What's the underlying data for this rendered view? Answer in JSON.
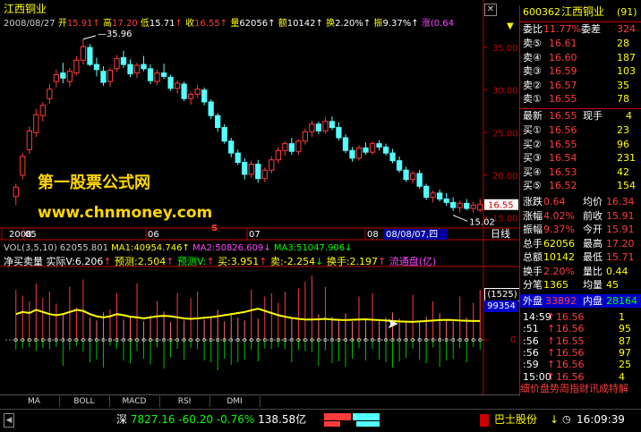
{
  "colors": {
    "up": "#ff3c3c",
    "down": "#54ffff",
    "ma_yellow": "#ffff00",
    "magenta": "#ff44ff",
    "green": "#00ff00",
    "axis": "#c00000",
    "cyan": "#00ffff"
  },
  "header": {
    "stock_name": "江西铜业",
    "date": "2008/08/27",
    "open_label": "开",
    "open": "15.91",
    "high_label": "高",
    "high": "17.20",
    "low_label": "低",
    "low": "15.71",
    "close_label": "收",
    "close": "16.55",
    "vol_label": "量",
    "vol": "62056",
    "amt_label": "额",
    "amt": "10142",
    "turnover_label": "换",
    "turnover": "2.20%",
    "amp_label": "振",
    "amp": "9.37%",
    "chg_label": "涨",
    "chg": "(0.64"
  },
  "price_axis": {
    "ticks": [
      "35.00",
      "30.00",
      "25.00",
      "20.00",
      "15.00"
    ],
    "current": "16.55",
    "hi_label": "35.96",
    "lo_label": "15.02",
    "marker": "S"
  },
  "time_axis": {
    "labels": [
      "2008",
      "05",
      "06",
      "07",
      "08"
    ],
    "cursor": "08/08/07,四",
    "period": "日线"
  },
  "vol_header": {
    "text": "VOL(3,5,10) 62055.801 ",
    "ma1": "MA1:40954.746",
    "ma2": "MA2:50826.609",
    "ma3": "MA3:51047.906"
  },
  "ind_header": {
    "name": "净买卖量",
    "actual": "实际V:6.206",
    "pred": "预测:2.504",
    "predv": "预测V:",
    "buy": "买:3.951",
    "sell": "卖:-2.254",
    "turn": "换手:2.197",
    "float": "流通盘(亿)"
  },
  "ind_axis": {
    "box1": "(1525)",
    "box2": "99354",
    "zero": "0"
  },
  "watermark": {
    "line1": "第一股票公式网",
    "line2": "www.chnmoney.com"
  },
  "tabs": [
    "MA",
    "BOLL",
    "MACD",
    "RSI",
    "DMI"
  ],
  "right_panel": {
    "code": "600362",
    "name": "江西铜业",
    "badge": "(91)",
    "wei_label": "委比",
    "wei_val": "11.77%",
    "wei_diff_label": "委差",
    "wei_diff": "324",
    "sells": [
      {
        "label": "卖⑤",
        "price": "16.61",
        "vol": "28"
      },
      {
        "label": "卖④",
        "price": "16.60",
        "vol": "187"
      },
      {
        "label": "卖③",
        "price": "16.59",
        "vol": "103"
      },
      {
        "label": "卖②",
        "price": "16.57",
        "vol": "35"
      },
      {
        "label": "卖①",
        "price": "16.55",
        "vol": "78"
      }
    ],
    "latest_label": "最新",
    "latest": "16.55",
    "cur_hand_label": "现手",
    "cur_hand": "4",
    "buys": [
      {
        "label": "买①",
        "price": "16.56",
        "vol": "23"
      },
      {
        "label": "买②",
        "price": "16.55",
        "vol": "96"
      },
      {
        "label": "买③",
        "price": "16.54",
        "vol": "231"
      },
      {
        "label": "买④",
        "price": "16.53",
        "vol": "42"
      },
      {
        "label": "买⑤",
        "price": "16.52",
        "vol": "154"
      }
    ],
    "stats": [
      [
        "涨跌",
        "0.64",
        "均价",
        "16.34"
      ],
      [
        "涨幅",
        "4.02%",
        "前收",
        "15.91"
      ],
      [
        "振幅",
        "9.37%",
        "今开",
        "15.91"
      ],
      [
        "总手",
        "62056",
        "最高",
        "17.20"
      ],
      [
        "总额",
        "10142",
        "最低",
        "15.71"
      ],
      [
        "换手",
        "2.20%",
        "量比",
        "0.44"
      ],
      [
        "分笔",
        "1365",
        "均量",
        "45"
      ]
    ],
    "outer_label": "外盘",
    "outer": "33892",
    "inner_label": "内盘",
    "inner": "28164",
    "ticks": [
      {
        "time": "14:59",
        "price": "16.56",
        "vol": "1"
      },
      {
        "time": ":51",
        "price": "16.56",
        "vol": "95"
      },
      {
        "time": ":56",
        "price": "16.55",
        "vol": "87"
      },
      {
        "time": ":56",
        "price": "16.56",
        "vol": "97"
      },
      {
        "time": ":59",
        "price": "16.56",
        "vol": "25"
      },
      {
        "time": "15:00",
        "price": "16.56",
        "vol": "4"
      }
    ],
    "bottom_tabs": "细价盘势周指财讯成特解"
  },
  "status": {
    "market": "深",
    "index": "7827.16",
    "change": "-60.20",
    "pct": "-0.76%",
    "amount": "138.58亿",
    "ticker": "巴士股份",
    "time": "16:09:39"
  },
  "chart_data": {
    "type": "candlestick",
    "note": "daily K-line; prices in CNY",
    "x_months": [
      "2008",
      "05",
      "06",
      "07",
      "08"
    ],
    "ylim": [
      14,
      37
    ],
    "candles": [
      [
        17.5,
        19.0,
        16.5,
        18.6
      ],
      [
        20,
        22.6,
        19.5,
        22.2
      ],
      [
        23,
        25.7,
        22.5,
        25.2
      ],
      [
        25,
        27.8,
        24.5,
        27.1
      ],
      [
        27,
        28.6,
        26.3,
        28.2
      ],
      [
        29,
        30.7,
        28.4,
        30.1
      ],
      [
        31,
        32.4,
        30.3,
        31.8
      ],
      [
        32,
        33.2,
        30.8,
        31.4
      ],
      [
        31,
        32.6,
        30.4,
        32.2
      ],
      [
        32,
        34.0,
        31.7,
        33.5
      ],
      [
        33.5,
        35.96,
        33.0,
        35.1
      ],
      [
        35,
        35.4,
        32.8,
        33.0
      ],
      [
        33,
        33.8,
        31.6,
        32.4
      ],
      [
        32.2,
        32.8,
        30.5,
        30.9
      ],
      [
        31,
        32.6,
        30.4,
        32.3
      ],
      [
        32.5,
        34.1,
        32.1,
        33.7
      ],
      [
        33.8,
        34.6,
        32.6,
        33.0
      ],
      [
        33,
        33.6,
        31.5,
        31.9
      ],
      [
        32,
        33.2,
        31.4,
        32.9
      ],
      [
        33,
        34.0,
        32.2,
        32.5
      ],
      [
        32.5,
        33.0,
        30.7,
        31.1
      ],
      [
        31,
        32.4,
        30.6,
        32.0
      ],
      [
        32,
        33.1,
        31.3,
        31.6
      ],
      [
        31.5,
        31.8,
        29.9,
        30.2
      ],
      [
        30.2,
        31.1,
        29.6,
        30.8
      ],
      [
        30.7,
        31.0,
        28.7,
        29.0
      ],
      [
        29,
        29.8,
        28.3,
        29.5
      ],
      [
        29.5,
        30.6,
        29.1,
        30.1
      ],
      [
        30,
        30.3,
        28.2,
        28.6
      ],
      [
        28.6,
        28.9,
        26.6,
        27.0
      ],
      [
        27,
        27.3,
        25.1,
        25.6
      ],
      [
        25.6,
        26.0,
        23.7,
        24.0
      ],
      [
        24,
        24.4,
        22.1,
        22.6
      ],
      [
        22.6,
        23.0,
        21.2,
        21.5
      ],
      [
        21.5,
        22.0,
        19.5,
        20.1
      ],
      [
        20.1,
        21.7,
        19.7,
        21.3
      ],
      [
        21.3,
        21.8,
        19.1,
        19.6
      ],
      [
        19.6,
        20.9,
        19.2,
        20.6
      ],
      [
        20.6,
        22.2,
        20.2,
        21.8
      ],
      [
        21.8,
        23.3,
        21.4,
        22.9
      ],
      [
        22.9,
        24.0,
        22.3,
        23.7
      ],
      [
        23.7,
        24.4,
        22.4,
        22.8
      ],
      [
        22.8,
        24.2,
        22.4,
        24.0
      ],
      [
        24,
        25.5,
        23.6,
        25.1
      ],
      [
        25.1,
        26.4,
        24.5,
        26.0
      ],
      [
        26,
        26.3,
        24.8,
        25.2
      ],
      [
        25.2,
        26.8,
        24.9,
        26.3
      ],
      [
        26.3,
        26.9,
        25.3,
        25.6
      ],
      [
        25.6,
        26.2,
        24.1,
        24.4
      ],
      [
        24.4,
        24.8,
        22.6,
        22.9
      ],
      [
        22.9,
        23.3,
        21.6,
        22.0
      ],
      [
        22,
        23.5,
        21.7,
        23.2
      ],
      [
        23.2,
        23.8,
        22.4,
        22.7
      ],
      [
        22.7,
        24.0,
        22.4,
        23.7
      ],
      [
        23.7,
        24.1,
        22.9,
        23.3
      ],
      [
        23.3,
        23.7,
        22.3,
        22.6
      ],
      [
        22.6,
        23.1,
        21.4,
        21.7
      ],
      [
        21.7,
        22.2,
        20.3,
        20.6
      ],
      [
        20.6,
        21.0,
        19.2,
        19.5
      ],
      [
        19.5,
        20.5,
        19.0,
        20.2
      ],
      [
        20.2,
        20.6,
        18.4,
        18.7
      ],
      [
        18.7,
        19.0,
        17.1,
        17.4
      ],
      [
        17.4,
        18.2,
        16.8,
        17.9
      ],
      [
        17.9,
        18.3,
        16.9,
        17.2
      ],
      [
        17.2,
        17.9,
        16.4,
        16.8
      ],
      [
        16.8,
        17.4,
        15.8,
        16.2
      ],
      [
        16.2,
        17.0,
        15.6,
        16.7
      ],
      [
        16.7,
        17.2,
        15.9,
        16.1
      ],
      [
        16.1,
        16.9,
        15.6,
        16.5
      ],
      [
        15.91,
        17.2,
        15.71,
        16.55
      ]
    ],
    "volume": [
      62,
      55,
      48,
      70,
      52,
      60,
      45,
      58,
      66,
      40,
      75,
      50,
      44,
      62,
      38,
      58,
      46,
      52,
      70,
      42,
      55,
      48,
      64,
      40,
      58,
      44,
      52,
      60,
      46,
      50,
      68,
      42,
      56,
      50,
      44,
      62,
      48,
      54,
      58,
      46,
      60,
      50,
      64,
      72,
      80,
      58,
      66,
      52,
      48,
      60,
      42,
      54,
      46,
      58,
      44,
      50,
      62,
      48,
      40,
      56,
      44,
      52,
      48,
      60,
      46,
      42,
      54,
      50,
      46,
      62
    ],
    "ma_line": [
      12,
      13,
      12.5,
      14,
      13,
      12,
      11.5,
      12,
      13,
      14,
      13.5,
      12,
      11,
      10.5,
      11,
      12,
      11.5,
      10.8,
      10.5,
      10,
      10.5,
      11,
      11.2,
      11,
      10.5,
      10,
      9.8,
      10,
      10.3,
      10.6,
      11,
      11.5,
      12,
      12.5,
      13,
      13.8,
      14.5,
      13.5,
      12.5,
      11.5,
      10.8,
      10.2,
      9.8,
      9.5,
      9.5,
      9.6,
      9.8,
      9.5,
      9.3,
      9.2,
      9.4,
      9.5,
      9.6,
      9.4,
      9.2,
      9.0,
      8.8,
      8.6,
      8.5,
      8.4,
      8.6,
      8.8,
      9.0,
      9.2,
      9.3,
      9.2,
      9.0,
      8.9,
      8.8,
      8.8
    ]
  }
}
